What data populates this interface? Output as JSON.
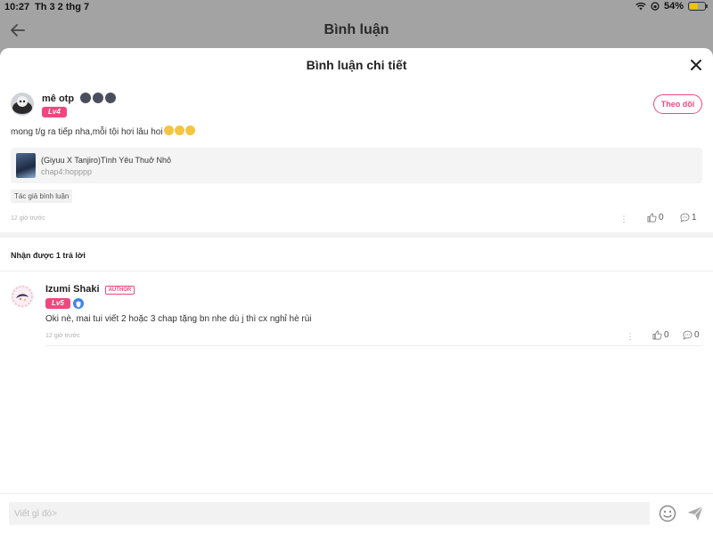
{
  "status_bar": {
    "time": "10:27",
    "date": "Th 3 2 thg 7",
    "battery": "54%",
    "battery_level": 0.54
  },
  "nav": {
    "title": "Bình luận",
    "back_icon": "arrow-left-icon"
  },
  "sheet": {
    "title": "Bình luận chi tiết",
    "close_icon": "close-icon"
  },
  "comment": {
    "username": "mê otp",
    "level": "Lv4",
    "follow_label": "Theo dõi",
    "text": "mong t/g ra tiếp nha,mỗi tội hơi lâu hoi",
    "story_title": "(Giyuu X Tanjiro)Tình Yêu Thuở Nhỏ",
    "story_chapter": "chap4:hopppp",
    "tag": "Tác giả bình luận",
    "timestamp": "12 giờ trước",
    "likes": "0",
    "replies": "1"
  },
  "replies_header": "Nhận được 1 trả lời",
  "reply": {
    "username": "Izumi Shaki",
    "author_tag": "AUTHOR",
    "level": "Lv5",
    "text": "Oki nè, mai tui viết 2 hoặc 3 chap tặng bn nhe dù j thì cx nghỉ hè rùi",
    "timestamp": "12 giờ trước",
    "likes": "0",
    "replies": "0"
  },
  "composer": {
    "placeholder": "Viết gì đó>"
  },
  "colors": {
    "accent": "#f0477e",
    "badge_blue": "#3f86e6"
  }
}
